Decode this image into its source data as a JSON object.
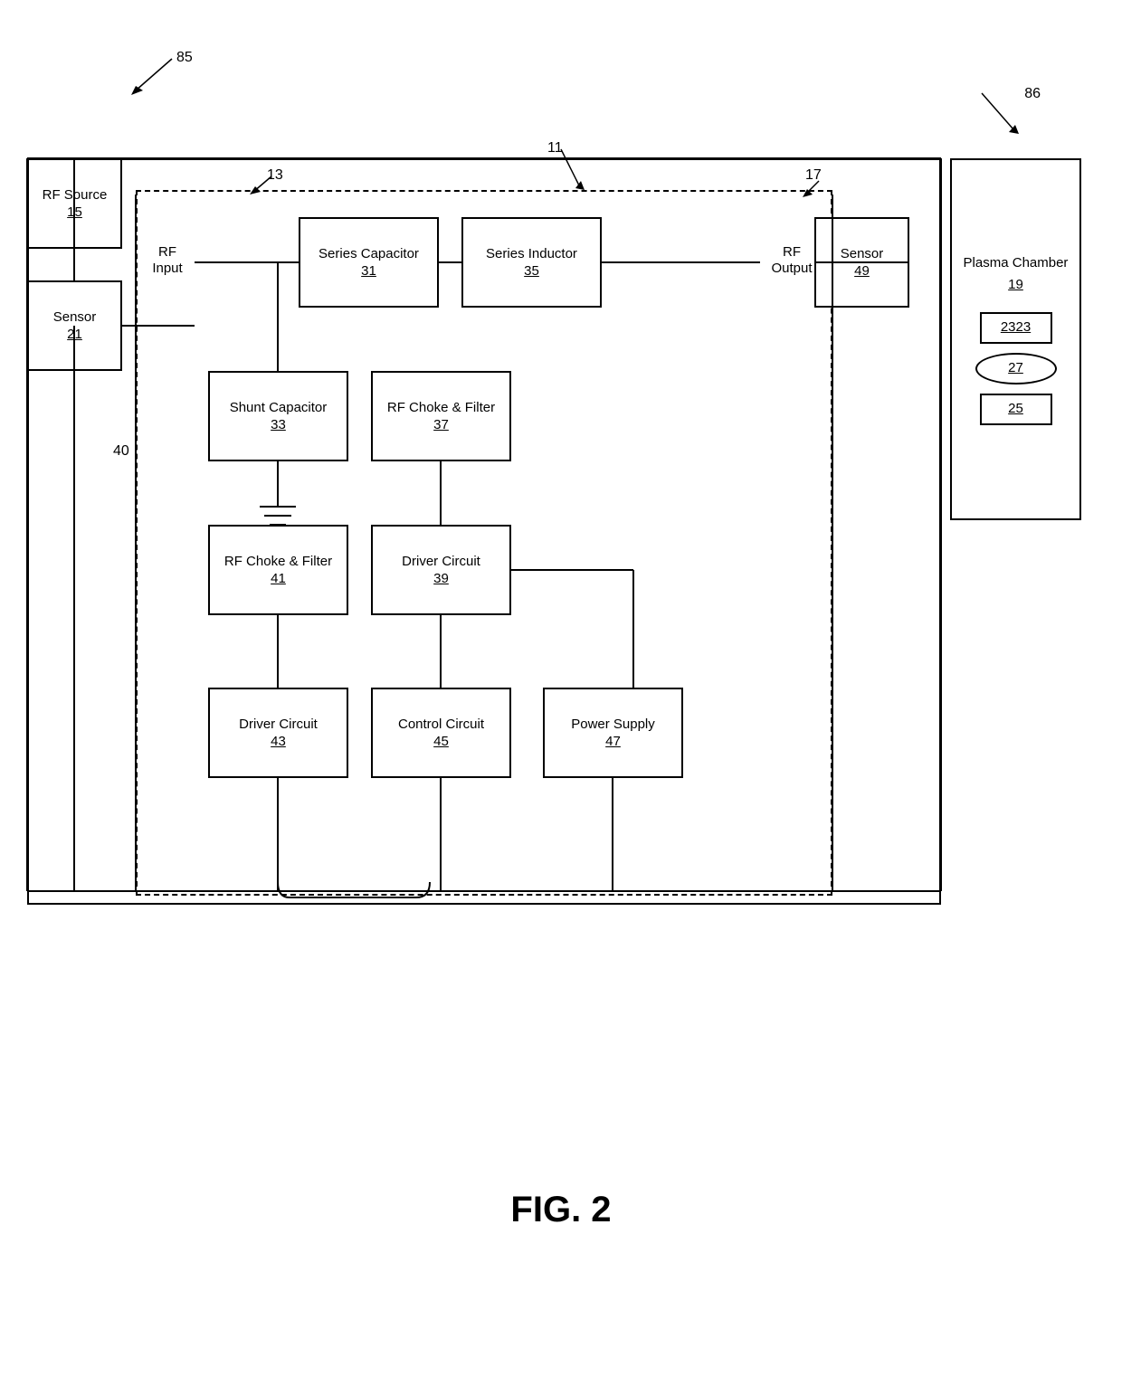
{
  "diagram": {
    "title": "FIG. 2",
    "callouts": {
      "c85": "85",
      "c86": "86",
      "c11": "11",
      "c13": "13",
      "c17": "17",
      "c40": "40"
    },
    "components": {
      "rf_source": {
        "label": "RF Source",
        "ref": "15"
      },
      "sensor_left": {
        "label": "Sensor",
        "ref": "21"
      },
      "series_capacitor": {
        "label": "Series Capacitor",
        "ref": "31"
      },
      "series_inductor": {
        "label": "Series Inductor",
        "ref": "35"
      },
      "sensor_right": {
        "label": "Sensor",
        "ref": "49"
      },
      "plasma_chamber": {
        "label": "Plasma Chamber",
        "ref": "19"
      },
      "plasma_23": {
        "label": "",
        "ref": "23"
      },
      "plasma_27": {
        "label": "",
        "ref": "27"
      },
      "plasma_25": {
        "label": "",
        "ref": "25"
      },
      "shunt_capacitor": {
        "label": "Shunt Capacitor",
        "ref": "33"
      },
      "rf_choke_filter_top": {
        "label": "RF Choke & Filter",
        "ref": "37"
      },
      "rf_choke_filter_left": {
        "label": "RF Choke & Filter",
        "ref": "41"
      },
      "driver_circuit_top": {
        "label": "Driver Circuit",
        "ref": "39"
      },
      "driver_circuit_bottom": {
        "label": "Driver Circuit",
        "ref": "43"
      },
      "control_circuit": {
        "label": "Control Circuit",
        "ref": "45"
      },
      "power_supply": {
        "label": "Power Supply",
        "ref": "47"
      }
    },
    "port_labels": {
      "rf_input": "RF\nInput",
      "rf_output": "RF\nOutput"
    }
  }
}
